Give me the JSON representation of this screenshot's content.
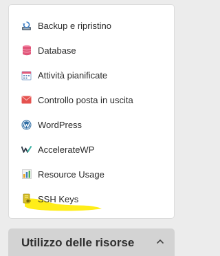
{
  "menu": {
    "items": [
      {
        "label": "Backup e ripristino",
        "icon": "backup-restore-icon"
      },
      {
        "label": "Database",
        "icon": "database-icon"
      },
      {
        "label": "Attività pianificate",
        "icon": "calendar-icon"
      },
      {
        "label": "Controllo posta in uscita",
        "icon": "mail-icon"
      },
      {
        "label": "WordPress",
        "icon": "wordpress-icon"
      },
      {
        "label": "AccelerateWP",
        "icon": "acceleratewp-icon"
      },
      {
        "label": "Resource Usage",
        "icon": "bar-chart-icon"
      },
      {
        "label": "SSH Keys",
        "icon": "ssh-key-icon"
      }
    ]
  },
  "resources_panel": {
    "title": "Utilizzo delle risorse",
    "toggle_icon": "chevron-up-icon"
  },
  "colors": {
    "highlight": "#ffeb00",
    "database_icon": "#e0567a",
    "mail_icon": "#e5524f",
    "wordpress_icon": "#2f6ea5",
    "panel_background": "#d3d3d3"
  }
}
